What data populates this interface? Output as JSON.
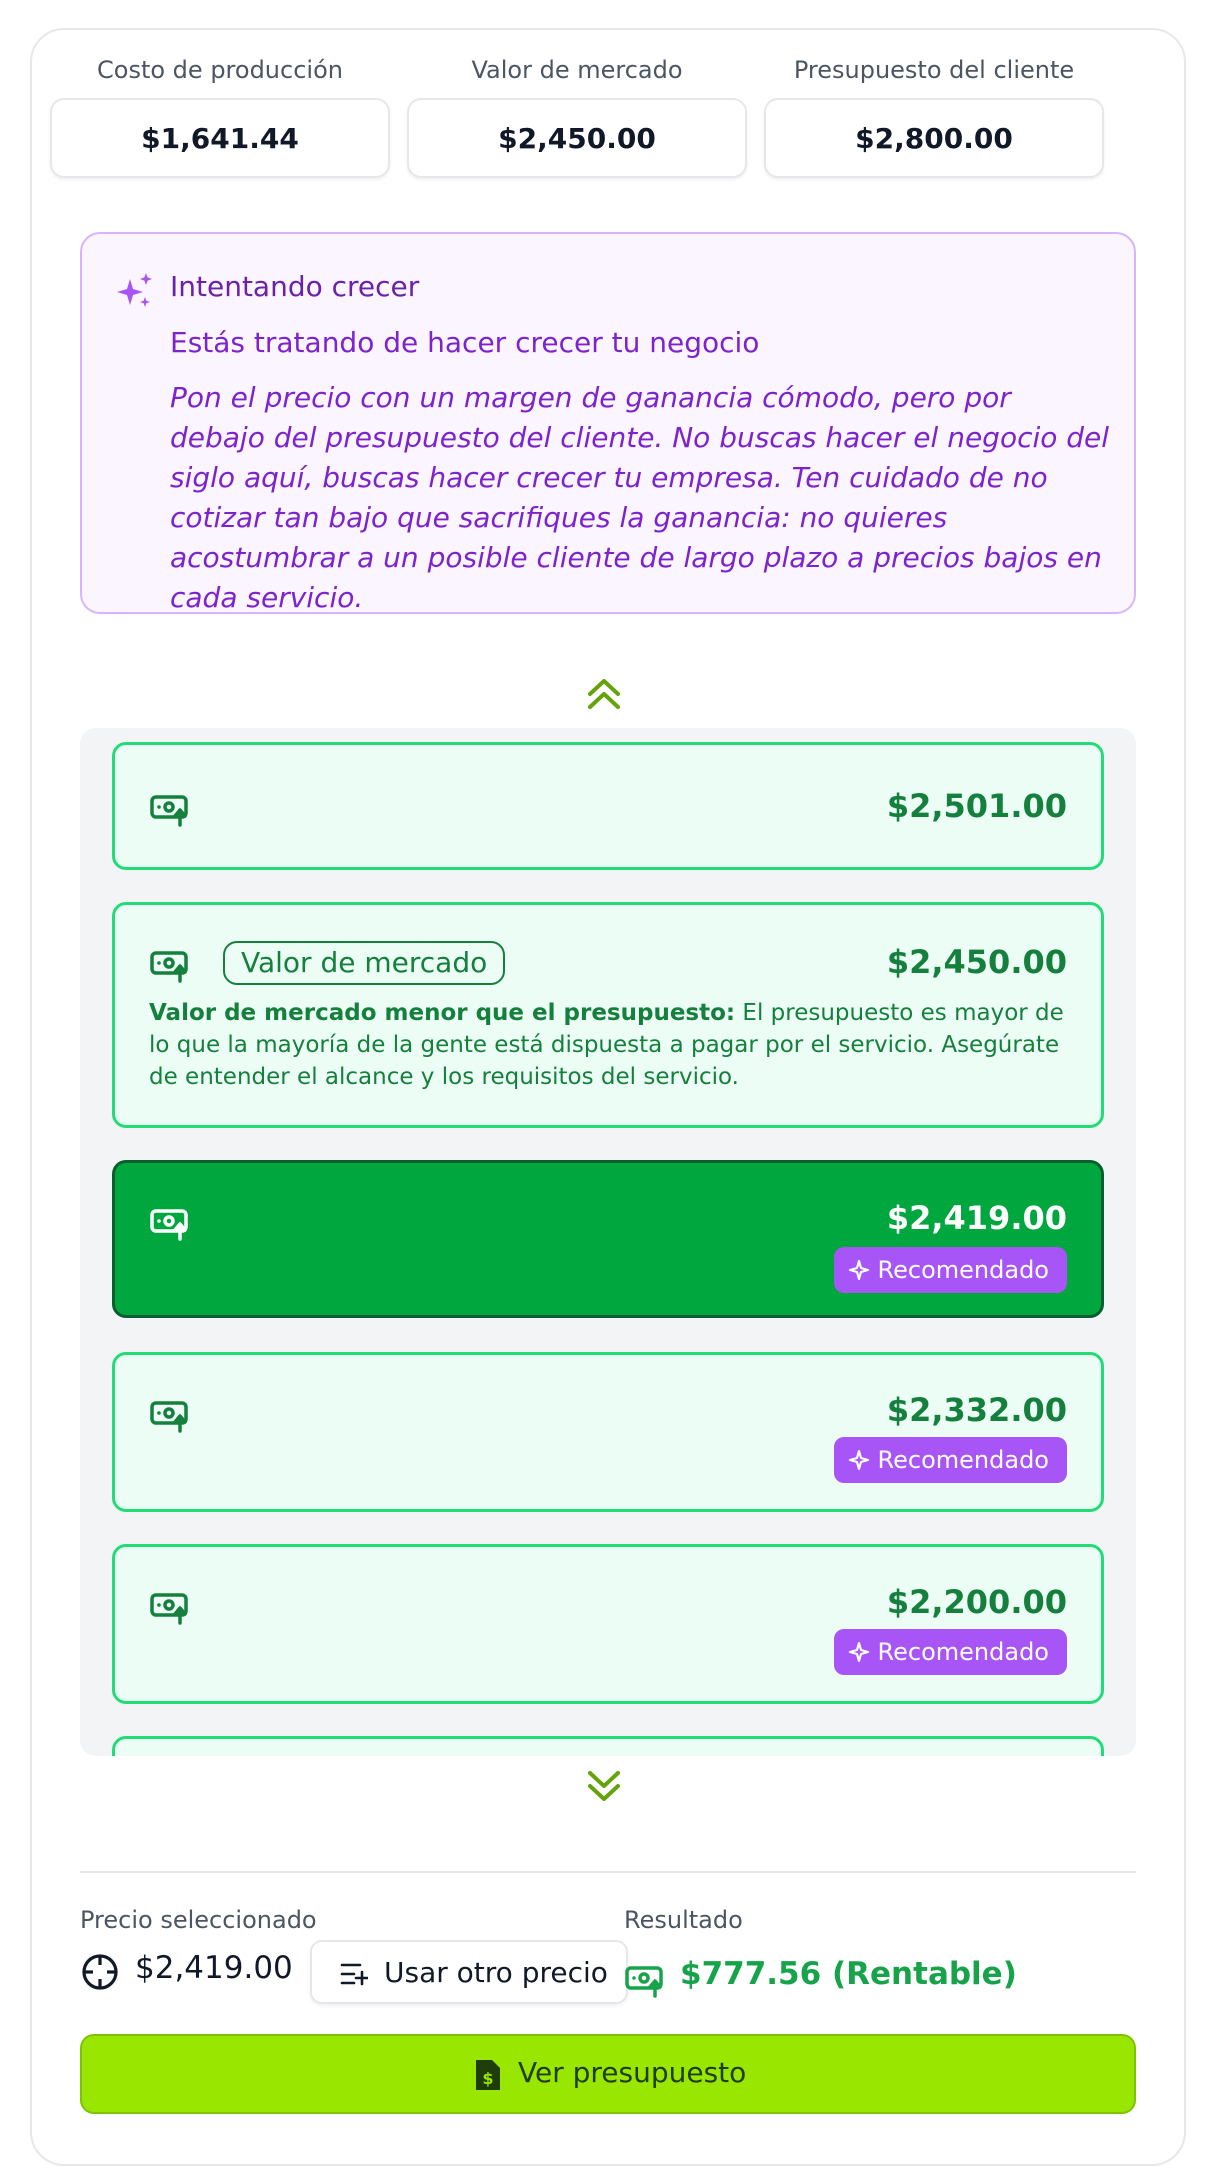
{
  "metrics": [
    {
      "label": "Costo de producción",
      "value": "$1,641.44"
    },
    {
      "label": "Valor de mercado",
      "value": "$2,450.00"
    },
    {
      "label": "Presupuesto del cliente",
      "value": "$2,800.00"
    }
  ],
  "strategy": {
    "title": "Intentando crecer",
    "subtitle": "Estás tratando de hacer crecer tu negocio",
    "body": "Pon el precio con un margen de ganancia cómodo, pero por debajo del presupuesto del cliente. No buscas hacer el negocio del siglo aquí, buscas hacer crecer tu empresa. Ten cuidado de no cotizar tan bajo que sacrifiques la ganancia: no quieres acostumbrar a un posible cliente de largo plazo a precios bajos en cada servicio."
  },
  "options": [
    {
      "price": "$2,501.00"
    },
    {
      "price": "$2,450.00",
      "chip": "Valor de mercado",
      "note_bold": "Valor de mercado menor que el presupuesto:",
      "note": " El presupuesto es mayor de lo que la mayoría de la gente está dispuesta a pagar por el servicio. Asegúrate de entender el alcance y los requisitos del servicio."
    },
    {
      "price": "$2,419.00",
      "badge": "Recomendado",
      "selected": true
    },
    {
      "price": "$2,332.00",
      "badge": "Recomendado"
    },
    {
      "price": "$2,200.00",
      "badge": "Recomendado"
    }
  ],
  "footer": {
    "selected_label": "Precio seleccionado",
    "selected_value": "$2,419.00",
    "other_price_label": "Usar otro precio",
    "result_label": "Resultado",
    "result_value": "$777.56 (Rentable)",
    "cta_label": "Ver presupuesto"
  },
  "colors": {
    "green_accent": "#22dd77",
    "selected_bg": "#00a63e",
    "recommend_badge": "#a855f7",
    "cta_bg": "#99e600",
    "strategy_bg": "#faf5ff"
  }
}
